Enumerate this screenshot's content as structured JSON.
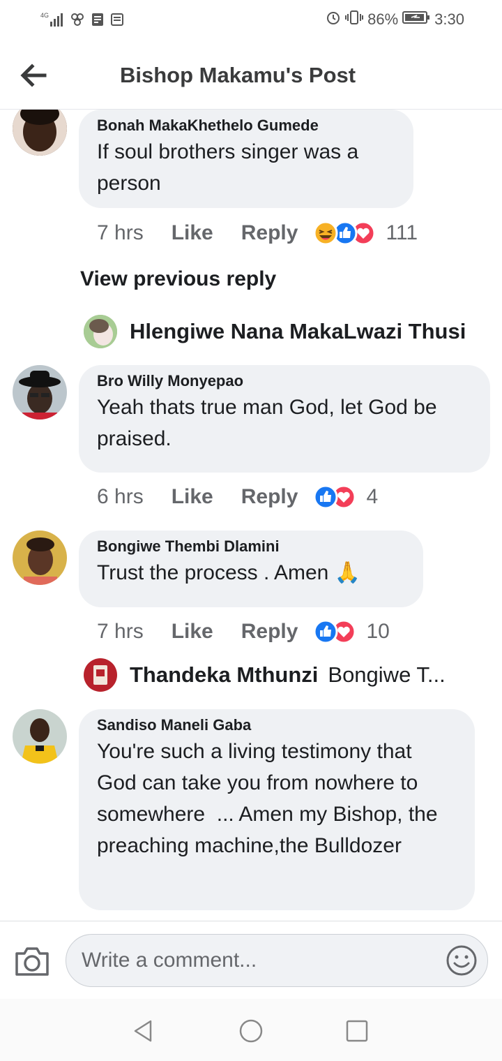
{
  "status_bar": {
    "network": "4G",
    "battery": "86%",
    "time": "3:30"
  },
  "header": {
    "title": "Bishop Makamu's Post"
  },
  "comments": [
    {
      "name": "Bonah MakaKhethelo Gumede",
      "text": "If soul brothers singer was a person",
      "time": "7 hrs",
      "like": "Like",
      "reply": "Reply",
      "reactions": [
        "haha",
        "like",
        "love"
      ],
      "reaction_count": "111"
    },
    {
      "name": "Bro Willy Monyepao",
      "text": "Yeah thats true man God, let God be praised.",
      "time": "6 hrs",
      "like": "Like",
      "reply": "Reply",
      "reactions": [
        "like",
        "love"
      ],
      "reaction_count": "4"
    },
    {
      "name": "Bongiwe Thembi Dlamini",
      "text": "Trust the process . Amen 🙏",
      "time": "7 hrs",
      "like": "Like",
      "reply": "Reply",
      "reactions": [
        "like",
        "love"
      ],
      "reaction_count": "10"
    },
    {
      "name": "Sandiso Maneli Gaba",
      "text": "You're such a living testimony that God can take you from nowhere to somewhere  ... Amen my Bishop, the preaching machine,the Bulldozer"
    }
  ],
  "view_previous_reply": "View previous reply",
  "replies": [
    {
      "name": "Hlengiwe Nana MakaLwazi Thusi",
      "text": ""
    },
    {
      "name": "Thandeka Mthunzi",
      "text": "Bongiwe T..."
    }
  ],
  "composer": {
    "placeholder": "Write a comment...",
    "camera_icon": "camera-icon",
    "emoji_icon": "emoji-icon"
  },
  "colors": {
    "bubble": "#eff1f4",
    "like_blue": "#1877f2",
    "love_red": "#f33e58",
    "haha_yellow": "#f7b125",
    "meta_gray": "#65676b"
  }
}
